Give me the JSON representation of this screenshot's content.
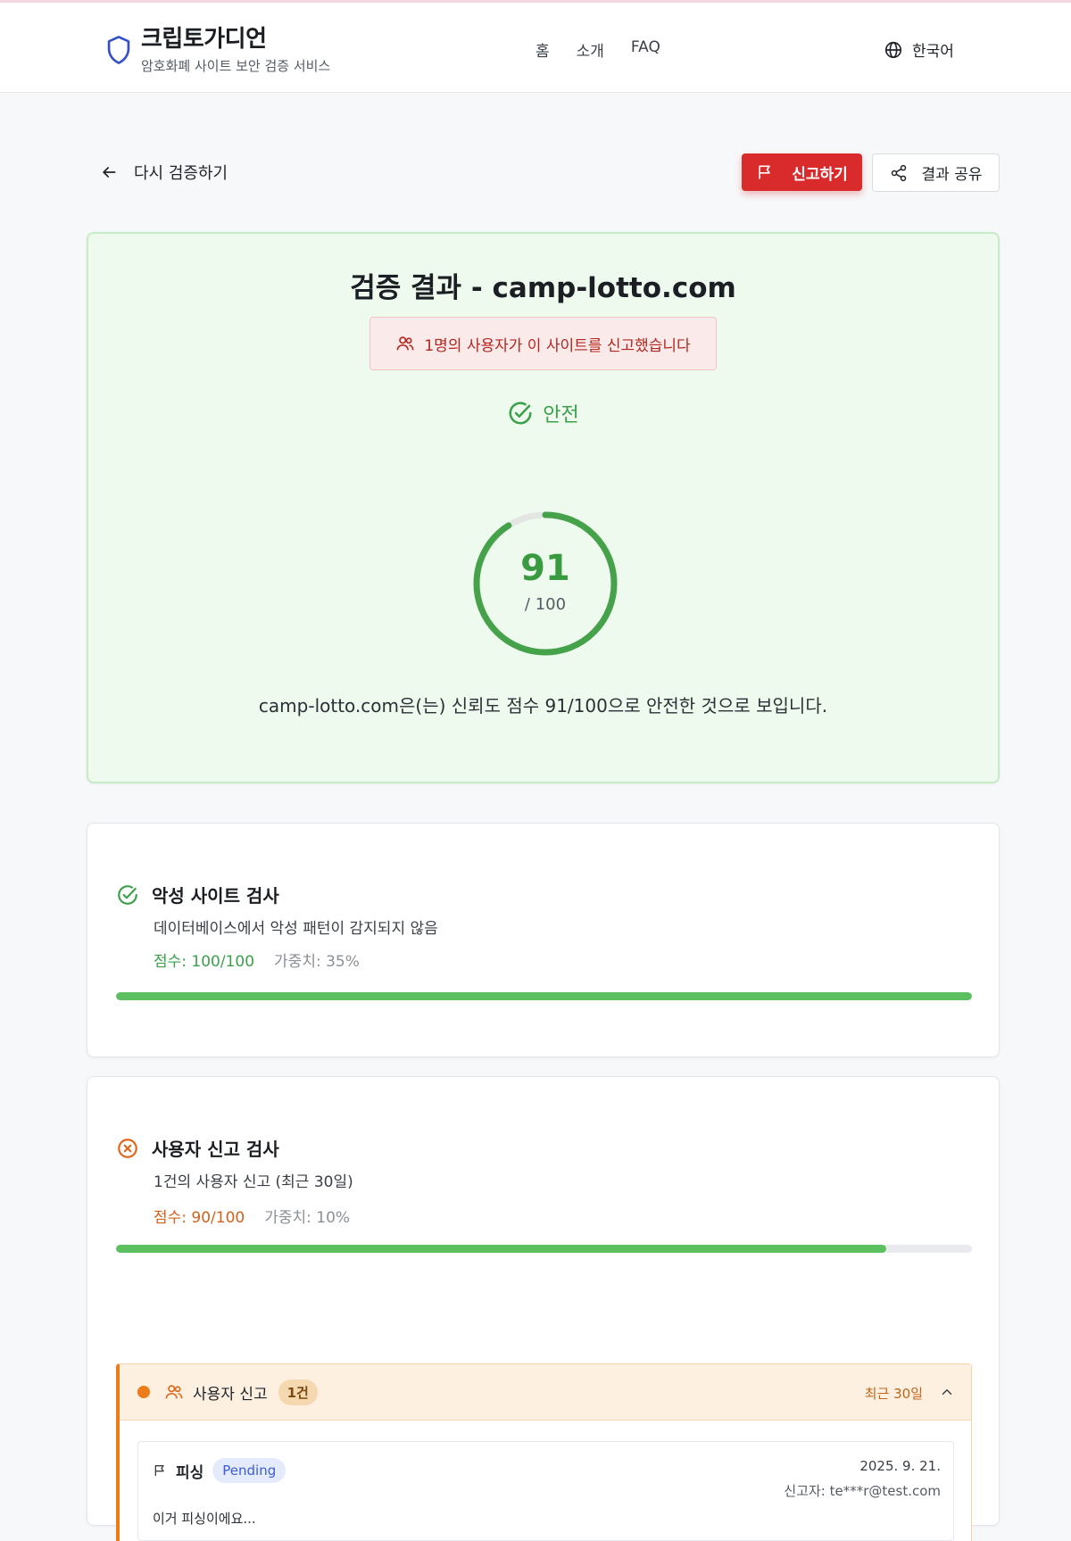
{
  "header": {
    "brand_title": "크립토가디언",
    "brand_subtitle": "암호화폐 사이트 보안 검증 서비스",
    "nav": [
      {
        "label": "홈"
      },
      {
        "label": "소개"
      },
      {
        "label": "FAQ"
      }
    ],
    "language": "한국어"
  },
  "toolbar": {
    "back_label": "다시 검증하기",
    "report_label": "신고하기",
    "share_label": "결과 공유"
  },
  "result": {
    "title": "검증 결과 - camp-lotto.com",
    "report_alert": "1명의 사용자가 이 사이트를 신고했습니다",
    "status": "안전",
    "score": 91,
    "score_display": "91",
    "score_max": "/ 100",
    "score_fraction": 0.91,
    "summary": "camp-lotto.com은(는) 신뢰도 점수 91/100으로 안전한 것으로 보입니다."
  },
  "checks": [
    {
      "title": "악성 사이트 검사",
      "description": "데이터베이스에서 악성 패턴이 감지되지 않음",
      "score_label": "점수: 100/100",
      "weight_label": "가중치: 35%",
      "progress": 1.0,
      "status": "pass"
    },
    {
      "title": "사용자 신고 검사",
      "description": "1건의 사용자 신고 (최근 30일)",
      "score_label": "점수: 90/100",
      "weight_label": "가중치: 10%",
      "progress": 0.9,
      "status": "fail"
    }
  ],
  "user_reports": {
    "label": "사용자 신고",
    "count": "1건",
    "period": "최근 30일",
    "items": [
      {
        "type": "피싱",
        "status": "Pending",
        "date": "2025. 9. 21.",
        "reporter": "신고자: te***r@test.com",
        "text": "이거 피싱이에요..."
      }
    ]
  },
  "colors": {
    "accent_red": "#d92b2b",
    "safe_green": "#3aa14a",
    "progress_green": "#5cc060",
    "warning_orange": "#ee7b1a"
  },
  "icons": {
    "brand": "shield-icon",
    "language": "globe-icon",
    "back": "arrow-left-icon",
    "report": "flag-icon",
    "share": "share-icon",
    "alert": "users-icon",
    "status": "check-circle-icon",
    "fail": "x-circle-icon",
    "collapse": "chevron-up-icon"
  }
}
